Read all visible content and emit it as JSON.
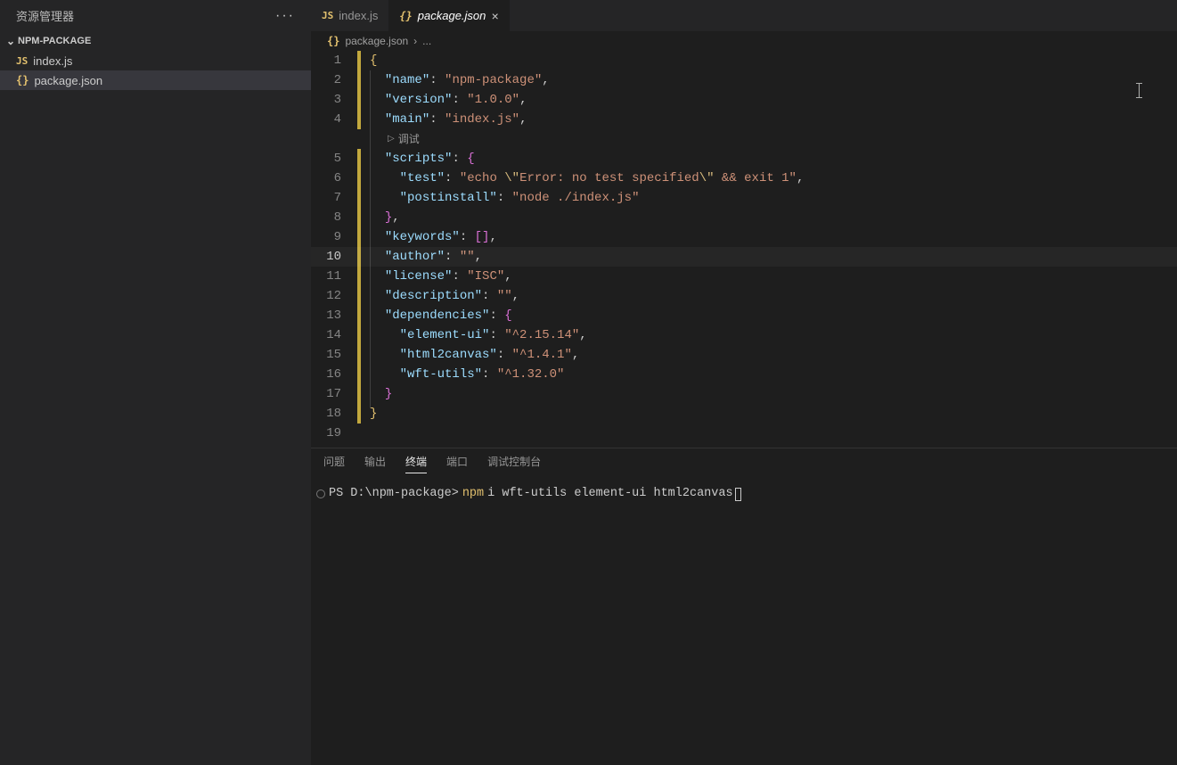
{
  "explorer": {
    "title": "资源管理器",
    "section": "NPM-PACKAGE",
    "items": [
      {
        "icon": "JS",
        "label": "index.js",
        "active": false
      },
      {
        "icon": "{}",
        "label": "package.json",
        "active": true
      }
    ]
  },
  "tabs": [
    {
      "icon": "JS",
      "label": "index.js",
      "active": false,
      "closeable": false
    },
    {
      "icon": "{}",
      "label": "package.json",
      "active": true,
      "closeable": true
    }
  ],
  "breadcrumb": {
    "icon": "{}",
    "file": "package.json",
    "rest": "..."
  },
  "editor": {
    "cursor_line": 10,
    "codelens_after_line": 4,
    "codelens_label": "调试",
    "lines": [
      {
        "n": 1,
        "tokens": [
          {
            "c": "brace",
            "t": "{"
          }
        ]
      },
      {
        "n": 2,
        "tokens": [
          {
            "c": "pad",
            "t": "  "
          },
          {
            "c": "keyq",
            "t": "\"name\""
          },
          {
            "c": "punc",
            "t": ": "
          },
          {
            "c": "str",
            "t": "\"npm-package\""
          },
          {
            "c": "punc",
            "t": ","
          }
        ]
      },
      {
        "n": 3,
        "tokens": [
          {
            "c": "pad",
            "t": "  "
          },
          {
            "c": "keyq",
            "t": "\"version\""
          },
          {
            "c": "punc",
            "t": ": "
          },
          {
            "c": "str",
            "t": "\"1.0.0\""
          },
          {
            "c": "punc",
            "t": ","
          }
        ]
      },
      {
        "n": 4,
        "tokens": [
          {
            "c": "pad",
            "t": "  "
          },
          {
            "c": "keyq",
            "t": "\"main\""
          },
          {
            "c": "punc",
            "t": ": "
          },
          {
            "c": "str",
            "t": "\"index.js\""
          },
          {
            "c": "punc",
            "t": ","
          }
        ]
      },
      {
        "n": 5,
        "tokens": [
          {
            "c": "pad",
            "t": "  "
          },
          {
            "c": "keyq",
            "t": "\"scripts\""
          },
          {
            "c": "punc",
            "t": ": "
          },
          {
            "c": "brace2",
            "t": "{"
          }
        ]
      },
      {
        "n": 6,
        "tokens": [
          {
            "c": "pad",
            "t": "    "
          },
          {
            "c": "keyq",
            "t": "\"test\""
          },
          {
            "c": "punc",
            "t": ": "
          },
          {
            "c": "str",
            "t": "\"echo "
          },
          {
            "c": "esc",
            "t": "\\\""
          },
          {
            "c": "str",
            "t": "Error: no test specified"
          },
          {
            "c": "esc",
            "t": "\\\""
          },
          {
            "c": "str",
            "t": " && exit 1\""
          },
          {
            "c": "punc",
            "t": ","
          }
        ]
      },
      {
        "n": 7,
        "tokens": [
          {
            "c": "pad",
            "t": "    "
          },
          {
            "c": "keyq",
            "t": "\"postinstall\""
          },
          {
            "c": "punc",
            "t": ": "
          },
          {
            "c": "str",
            "t": "\"node ./index.js\""
          }
        ]
      },
      {
        "n": 8,
        "tokens": [
          {
            "c": "pad",
            "t": "  "
          },
          {
            "c": "brace2",
            "t": "}"
          },
          {
            "c": "punc",
            "t": ","
          }
        ]
      },
      {
        "n": 9,
        "tokens": [
          {
            "c": "pad",
            "t": "  "
          },
          {
            "c": "keyq",
            "t": "\"keywords\""
          },
          {
            "c": "punc",
            "t": ": "
          },
          {
            "c": "bracket",
            "t": "[]"
          },
          {
            "c": "punc",
            "t": ","
          }
        ]
      },
      {
        "n": 10,
        "tokens": [
          {
            "c": "pad",
            "t": "  "
          },
          {
            "c": "keyq",
            "t": "\"author\""
          },
          {
            "c": "punc",
            "t": ": "
          },
          {
            "c": "str",
            "t": "\"\""
          },
          {
            "c": "punc",
            "t": ","
          }
        ]
      },
      {
        "n": 11,
        "tokens": [
          {
            "c": "pad",
            "t": "  "
          },
          {
            "c": "keyq",
            "t": "\"license\""
          },
          {
            "c": "punc",
            "t": ": "
          },
          {
            "c": "str",
            "t": "\"ISC\""
          },
          {
            "c": "punc",
            "t": ","
          }
        ]
      },
      {
        "n": 12,
        "tokens": [
          {
            "c": "pad",
            "t": "  "
          },
          {
            "c": "keyq",
            "t": "\"description\""
          },
          {
            "c": "punc",
            "t": ": "
          },
          {
            "c": "str",
            "t": "\"\""
          },
          {
            "c": "punc",
            "t": ","
          }
        ]
      },
      {
        "n": 13,
        "tokens": [
          {
            "c": "pad",
            "t": "  "
          },
          {
            "c": "keyq",
            "t": "\"dependencies\""
          },
          {
            "c": "punc",
            "t": ": "
          },
          {
            "c": "brace2",
            "t": "{"
          }
        ]
      },
      {
        "n": 14,
        "tokens": [
          {
            "c": "pad",
            "t": "    "
          },
          {
            "c": "keyq",
            "t": "\"element-ui\""
          },
          {
            "c": "punc",
            "t": ": "
          },
          {
            "c": "str",
            "t": "\"^2.15.14\""
          },
          {
            "c": "punc",
            "t": ","
          }
        ]
      },
      {
        "n": 15,
        "tokens": [
          {
            "c": "pad",
            "t": "    "
          },
          {
            "c": "keyq",
            "t": "\"html2canvas\""
          },
          {
            "c": "punc",
            "t": ": "
          },
          {
            "c": "str",
            "t": "\"^1.4.1\""
          },
          {
            "c": "punc",
            "t": ","
          }
        ]
      },
      {
        "n": 16,
        "tokens": [
          {
            "c": "pad",
            "t": "    "
          },
          {
            "c": "keyq",
            "t": "\"wft-utils\""
          },
          {
            "c": "punc",
            "t": ": "
          },
          {
            "c": "str",
            "t": "\"^1.32.0\""
          }
        ]
      },
      {
        "n": 17,
        "tokens": [
          {
            "c": "pad",
            "t": "  "
          },
          {
            "c": "brace2",
            "t": "}"
          }
        ]
      },
      {
        "n": 18,
        "tokens": [
          {
            "c": "brace",
            "t": "}"
          }
        ]
      },
      {
        "n": 19,
        "tokens": []
      }
    ]
  },
  "panel": {
    "tabs": [
      "问题",
      "输出",
      "终端",
      "端口",
      "调试控制台"
    ],
    "active_tab": "终端",
    "terminal": {
      "prompt": "PS D:\\npm-package>",
      "cmd_exe": "npm",
      "cmd_args": "i wft-utils element-ui html2canvas"
    }
  }
}
